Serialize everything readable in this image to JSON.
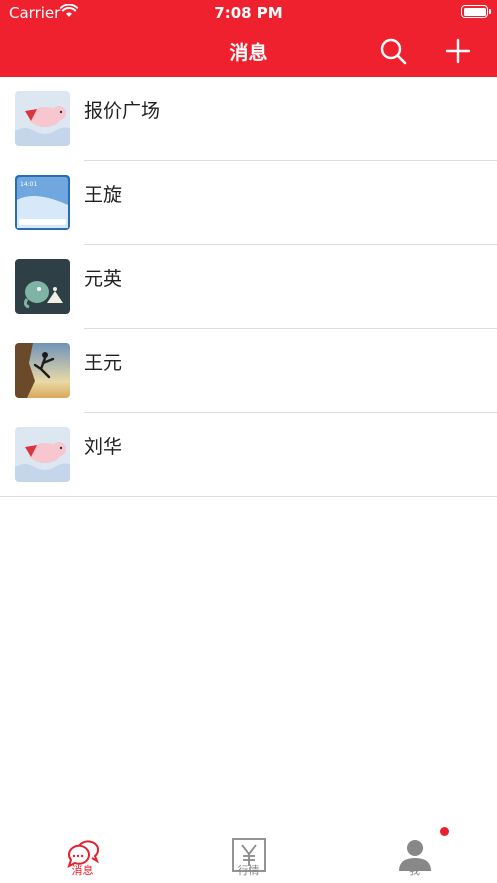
{
  "status_bar": {
    "carrier": "Carrier",
    "time": "7:08 PM"
  },
  "nav": {
    "title": "消息",
    "search_icon": "search-icon",
    "add_icon": "plus-icon"
  },
  "conversations": [
    {
      "name": "报价广场",
      "avatar": "flying-pig-avatar"
    },
    {
      "name": "王旋",
      "avatar": "phone-screenshot-avatar"
    },
    {
      "name": "元英",
      "avatar": "cartoon-elephant-avatar"
    },
    {
      "name": "王元",
      "avatar": "climber-avatar"
    },
    {
      "name": "刘华",
      "avatar": "flying-pig-avatar"
    }
  ],
  "tabbar": {
    "tabs": [
      {
        "label": "消息",
        "icon": "chat-bubbles-icon",
        "active": true
      },
      {
        "label": "行情",
        "icon": "yuan-icon",
        "active": false
      },
      {
        "label": "我",
        "icon": "person-icon",
        "active": false,
        "badge": true
      }
    ]
  },
  "colors": {
    "brand_red": "#f0212f",
    "separator": "#dedede",
    "inactive_tab": "#888888"
  }
}
